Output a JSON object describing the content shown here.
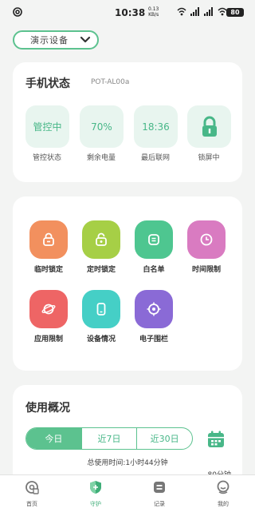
{
  "status_bar": {
    "time": "10:38",
    "speed_value": "0.13",
    "speed_unit": "KB/s",
    "battery": "80"
  },
  "device_selector": {
    "label": "演示设备"
  },
  "phone_status": {
    "title": "手机状态",
    "model": "POT-AL00a",
    "tiles": [
      {
        "value": "管控中",
        "label": "管控状态"
      },
      {
        "value": "70%",
        "label": "剩余电量"
      },
      {
        "value": "18:36",
        "label": "最后联网"
      },
      {
        "icon": "lock-icon",
        "label": "锁屏中"
      }
    ]
  },
  "functions": [
    {
      "label": "临时锁定",
      "icon": "lock-icon",
      "color": "#f2905e"
    },
    {
      "label": "定时锁定",
      "icon": "timed-lock-icon",
      "color": "#a6cf46"
    },
    {
      "label": "白名单",
      "icon": "list-icon",
      "color": "#4ec690"
    },
    {
      "label": "时间限制",
      "icon": "clock-icon",
      "color": "#d97bc1"
    },
    {
      "label": "应用限制",
      "icon": "planet-icon",
      "color": "#ee6565"
    },
    {
      "label": "设备情况",
      "icon": "phone-icon",
      "color": "#45cfc6"
    },
    {
      "label": "电子围栏",
      "icon": "target-icon",
      "color": "#8a6ad6"
    }
  ],
  "usage": {
    "title": "使用概况",
    "tabs": [
      "今日",
      "近7日",
      "近30日"
    ],
    "active_tab": "今日",
    "total_label": "总使用时间:1小时44分钟",
    "minutes_label": "80分钟"
  },
  "bottom_nav": [
    {
      "label": "首页",
      "icon": "home-icon"
    },
    {
      "label": "守护",
      "icon": "shield-icon",
      "active": true
    },
    {
      "label": "记录",
      "icon": "record-icon"
    },
    {
      "label": "我的",
      "icon": "profile-icon"
    }
  ],
  "colors": {
    "accent": "#5cc28f",
    "tile_bg": "#e8f5ef",
    "page_bg": "#f3f4f3"
  }
}
